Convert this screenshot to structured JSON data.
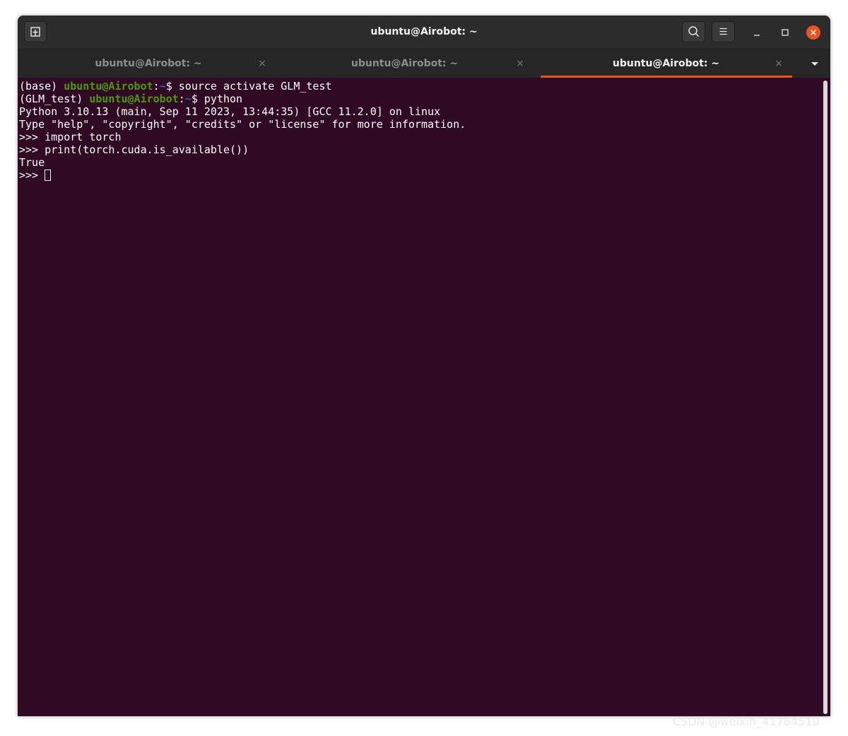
{
  "window": {
    "title": "ubuntu@Airobot: ~"
  },
  "header_buttons": {
    "new_tab_icon": "new-tab-icon",
    "search_icon": "search-icon",
    "menu_icon": "hamburger-menu-icon",
    "minimize_icon": "minimize-icon",
    "maximize_icon": "maximize-icon",
    "close_icon": "close-icon"
  },
  "tabs": [
    {
      "label": "ubuntu@Airobot: ~",
      "close": "×",
      "active": false
    },
    {
      "label": "ubuntu@Airobot: ~",
      "close": "×",
      "active": false
    },
    {
      "label": "ubuntu@Airobot: ~",
      "close": "×",
      "active": true
    }
  ],
  "terminal": {
    "line1": {
      "env": "(base) ",
      "user": "ubuntu@Airobot",
      "sep": ":",
      "path": "~",
      "cmd": "$ source activate GLM_test"
    },
    "line2": {
      "env": "(GLM_test) ",
      "user": "ubuntu@Airobot",
      "sep": ":",
      "path": "~",
      "cmd": "$ python"
    },
    "line3": "Python 3.10.13 (main, Sep 11 2023, 13:44:35) [GCC 11.2.0] on linux",
    "line4": "Type \"help\", \"copyright\", \"credits\" or \"license\" for more information.",
    "line5": ">>> import torch",
    "line6": ">>> print(torch.cuda.is_available())",
    "line7": "True",
    "line8": ">>> "
  },
  "watermark": "CSDN @weixin_41784510",
  "colors": {
    "terminal_bg": "#300a24",
    "prompt_user": "#4e9a06",
    "prompt_path": "#3465a4",
    "accent": "#e95420"
  }
}
